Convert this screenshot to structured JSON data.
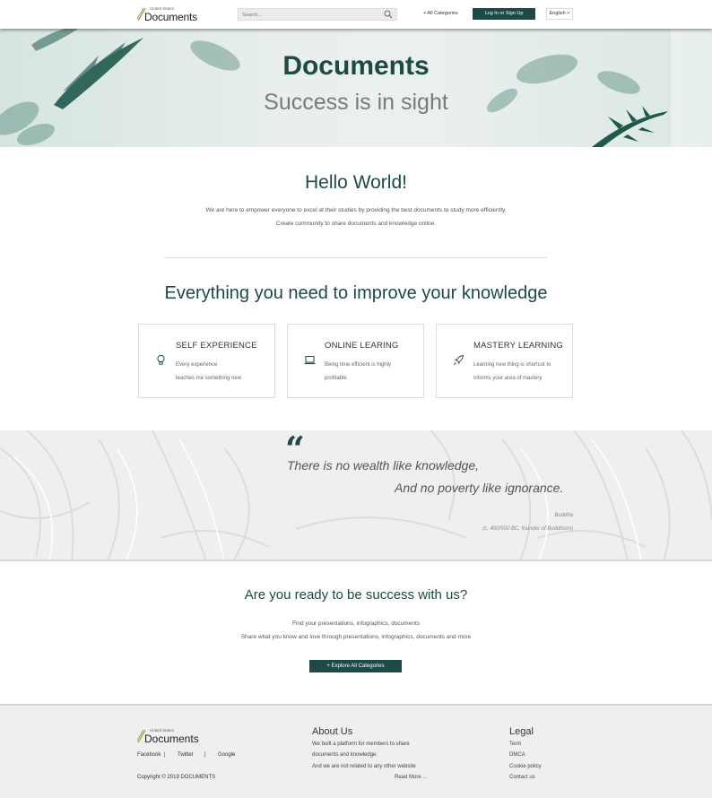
{
  "header": {
    "logo_small": "United States",
    "logo_big": "Documents",
    "search_placeholder": "Search...",
    "all_categories": "+ All Categories",
    "login": "Log In or Sign Up",
    "language": "English >"
  },
  "hero": {
    "title": "Documents",
    "subtitle": "Success is in sight"
  },
  "intro": {
    "heading": "Hello World!",
    "line1": "We are here to empower everyone to excel at their studies by providing the best documents to study more efficiently.",
    "line2": "Create community to share documents and knowledge online."
  },
  "features": {
    "heading": "Everything you need to improve your knowledge",
    "cards": [
      {
        "title": "SELF EXPERIENCE",
        "line1": "Every experience",
        "line2": "teaches me something new",
        "icon": "lightbulb-icon"
      },
      {
        "title": "ONLINE LEARING",
        "line1": "Being time efficient is highly",
        "line2": "profitable",
        "icon": "laptop-icon"
      },
      {
        "title": "MASTERY LEARNING",
        "line1": "Learning new thing is shortcut to",
        "line2": "informs your area of mastery",
        "icon": "rocket-icon"
      }
    ]
  },
  "quote": {
    "line1": "There is no wealth like knowledge,",
    "line2": "And no poverty like ignorance.",
    "author": "Buddha",
    "era": "(c. 400/500 BC, founder of Buddhism)"
  },
  "cta": {
    "heading": "Are you ready to be success with us?",
    "line1": "Find your presentations, infographics, documents",
    "line2": "Share what you know and love through presentations, infographics, documents and more",
    "button": "+ Explore All Categories"
  },
  "footer": {
    "logo_small": "United States",
    "logo_big": "Documents",
    "social": [
      "Facebook",
      "Twitter",
      "Google"
    ],
    "separator": "|",
    "copyright": "Copyright © 2019 DOCUMENTS",
    "about_heading": "About Us",
    "about_lines": [
      "We built a platform for members to share",
      "documents and knowledge.",
      "And we are not related to any other website"
    ],
    "read_more": "Read More ...",
    "legal_heading": "Legal",
    "legal_links": [
      "Term",
      "DMCA",
      "Cookie policy",
      "Contact us"
    ]
  },
  "colors": {
    "brand": "#1d4a45",
    "footer_bg": "#efefef"
  }
}
